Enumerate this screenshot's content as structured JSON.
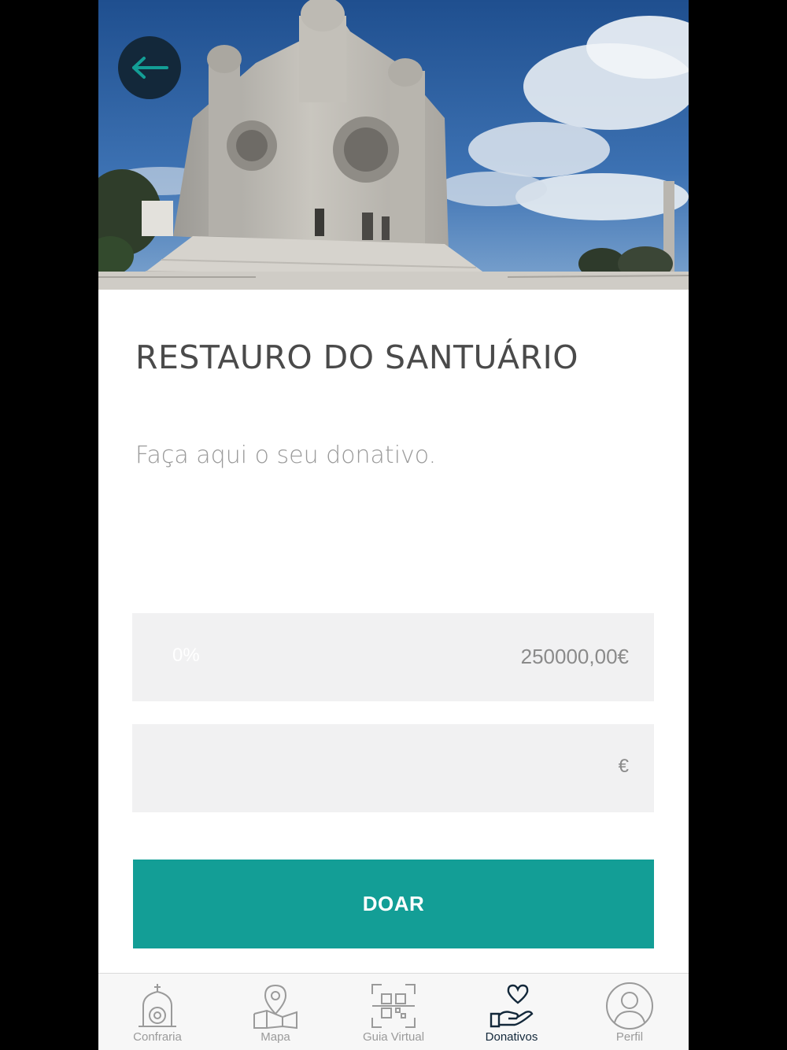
{
  "hero": {
    "image_description": "sanctuary-photo",
    "back_icon": "arrow-left-icon"
  },
  "campaign": {
    "title": "RESTAURO DO SANTUÁRIO",
    "subtitle": "Faça aqui o seu donativo."
  },
  "progress": {
    "percent_label": "0%",
    "percent": 0,
    "goal_label": "250000,00€"
  },
  "amount": {
    "value": "",
    "currency": "€"
  },
  "donate_button": {
    "label": "DOAR"
  },
  "tabs": [
    {
      "label": "Confraria",
      "icon": "church-icon",
      "active": false
    },
    {
      "label": "Mapa",
      "icon": "map-pin-icon",
      "active": false
    },
    {
      "label": "Guia Virtual",
      "icon": "qr-code-icon",
      "active": false
    },
    {
      "label": "Donativos",
      "icon": "heart-hand-icon",
      "active": true
    },
    {
      "label": "Perfil",
      "icon": "user-icon",
      "active": false
    }
  ],
  "colors": {
    "accent": "#139e96",
    "dark": "#13283a",
    "field_bg": "#f1f1f2"
  }
}
